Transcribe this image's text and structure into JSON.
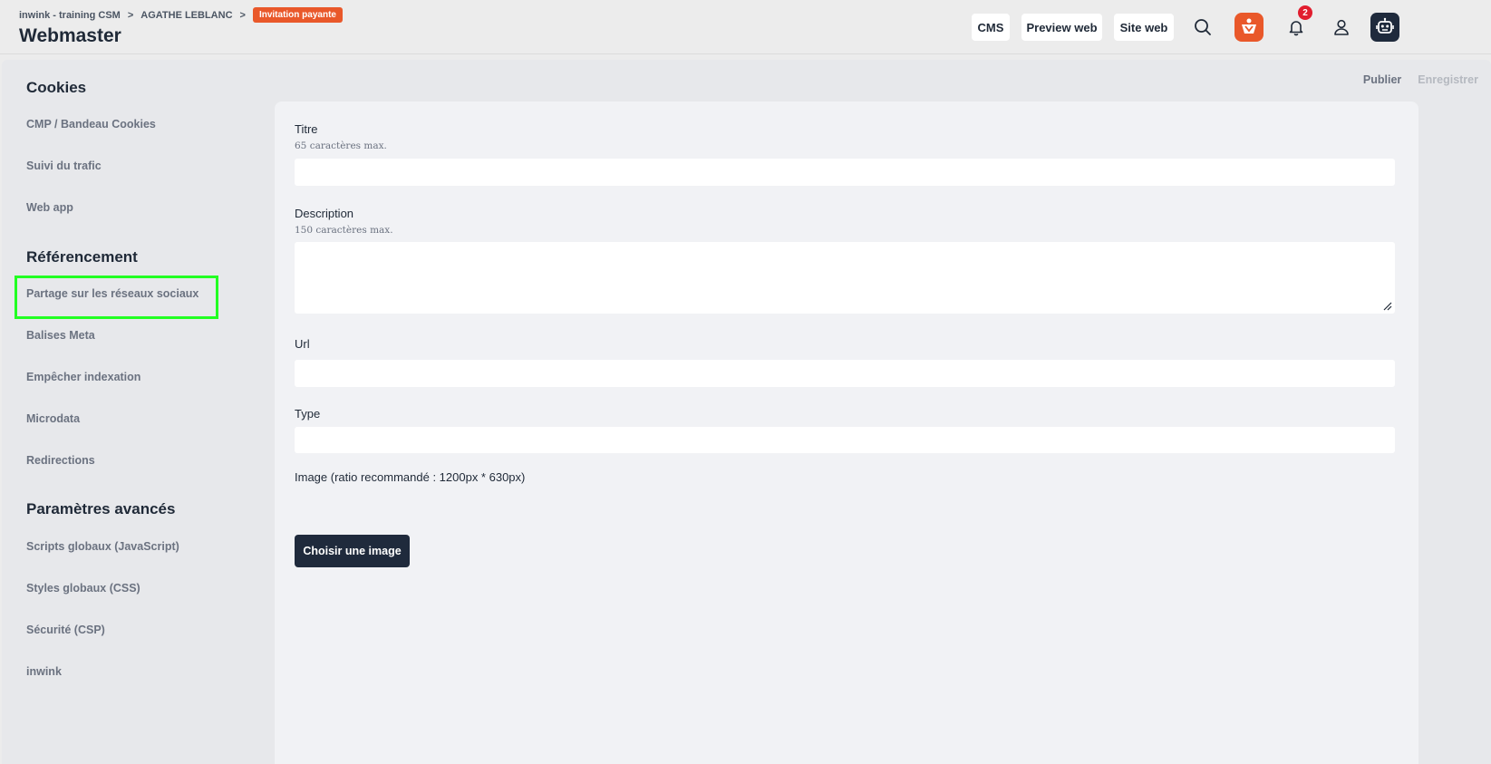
{
  "header": {
    "breadcrumb": {
      "org": "inwink - training CSM",
      "sep": ">",
      "event": "AGATHE LEBLANC",
      "badge": "Invitation payante"
    },
    "title": "Webmaster",
    "buttons": {
      "cms": "CMS",
      "preview": "Preview web",
      "site": "Site web"
    },
    "notification_count": "2",
    "brand_color": "#e9582a"
  },
  "sidebar": {
    "sections": [
      {
        "title": "Cookies",
        "items": [
          "CMP / Bandeau Cookies",
          "Suivi du trafic",
          "Web app"
        ]
      },
      {
        "title": "Référencement",
        "items": [
          "Partage sur les réseaux sociaux",
          "Balises Meta",
          "Empêcher indexation",
          "Microdata",
          "Redirections"
        ]
      },
      {
        "title": "Paramètres avancés",
        "items": [
          "Scripts globaux (JavaScript)",
          "Styles globaux (CSS)",
          "Sécurité (CSP)",
          "inwink"
        ]
      }
    ],
    "selected": "Partage sur les réseaux sociaux"
  },
  "actions": {
    "publish": "Publier",
    "save": "Enregistrer"
  },
  "form": {
    "title": {
      "label": "Titre",
      "hint": "65 caractères max.",
      "value": ""
    },
    "description": {
      "label": "Description",
      "hint": "150 caractères max.",
      "value": ""
    },
    "url": {
      "label": "Url",
      "value": ""
    },
    "type": {
      "label": "Type",
      "value": ""
    },
    "image": {
      "label": "Image (ratio recommandé : 1200px * 630px)",
      "button": "Choisir une image"
    }
  }
}
